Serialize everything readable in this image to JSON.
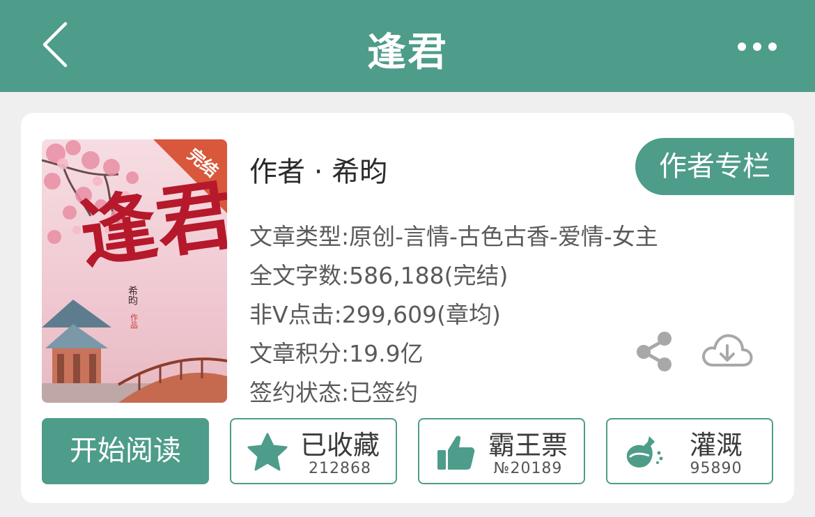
{
  "header": {
    "title": "逢君"
  },
  "book": {
    "cover": {
      "badge": "完结",
      "title": "逢君",
      "author_vertical": "希昀",
      "suffix": "作品"
    },
    "author_line": "作者 · 希昀",
    "author_column_label": "作者专栏",
    "info": [
      "文章类型:原创-言情-古色古香-爱情-女主",
      "全文字数:586,188(完结)",
      "非V点击:299,609(章均)",
      "文章积分:19.9亿",
      "签约状态:已签约"
    ]
  },
  "actions": {
    "start_label": "开始阅读",
    "favorite": {
      "label": "已收藏",
      "count": "212868"
    },
    "ticket": {
      "label": "霸王票",
      "count": "№20189"
    },
    "water": {
      "label": "灌溉",
      "count": "95890"
    }
  },
  "colors": {
    "accent": "#4e9c8a",
    "background": "#efefef"
  }
}
